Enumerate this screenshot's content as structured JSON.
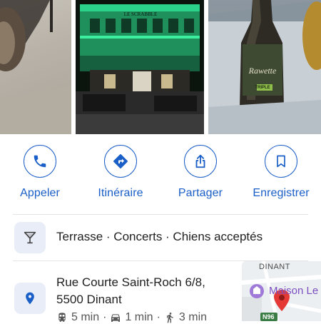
{
  "actions": [
    {
      "label": "Appeler",
      "icon": "phone-icon"
    },
    {
      "label": "Itinéraire",
      "icon": "directions-icon"
    },
    {
      "label": "Partager",
      "icon": "share-icon"
    },
    {
      "label": "Enregistrer",
      "icon": "bookmark-icon"
    }
  ],
  "features": {
    "text": "Terrasse · Concerts · Chiens acceptés",
    "icon": "cocktail-icon"
  },
  "address": {
    "line1": "Rue Courte Saint-Roch 6/8,",
    "line2": "5500 Dinant",
    "icon": "location-pin-icon",
    "transit": {
      "transit_time": "5 min",
      "drive_time": "1 min",
      "walk_time": "3 min"
    }
  },
  "photos": {
    "bottle_label": "Rawette",
    "bottle_sublabel": "TRIPLE",
    "sign_text": "LE SCRABBLE"
  },
  "map": {
    "street_label": "DINANT",
    "poi_label": "Maison Le",
    "road_label": "N96"
  },
  "colors": {
    "accent": "#1a5ec7",
    "icon_bg": "#e8edf8",
    "pin": "#e53935",
    "sign_green": "#2bd38a"
  }
}
